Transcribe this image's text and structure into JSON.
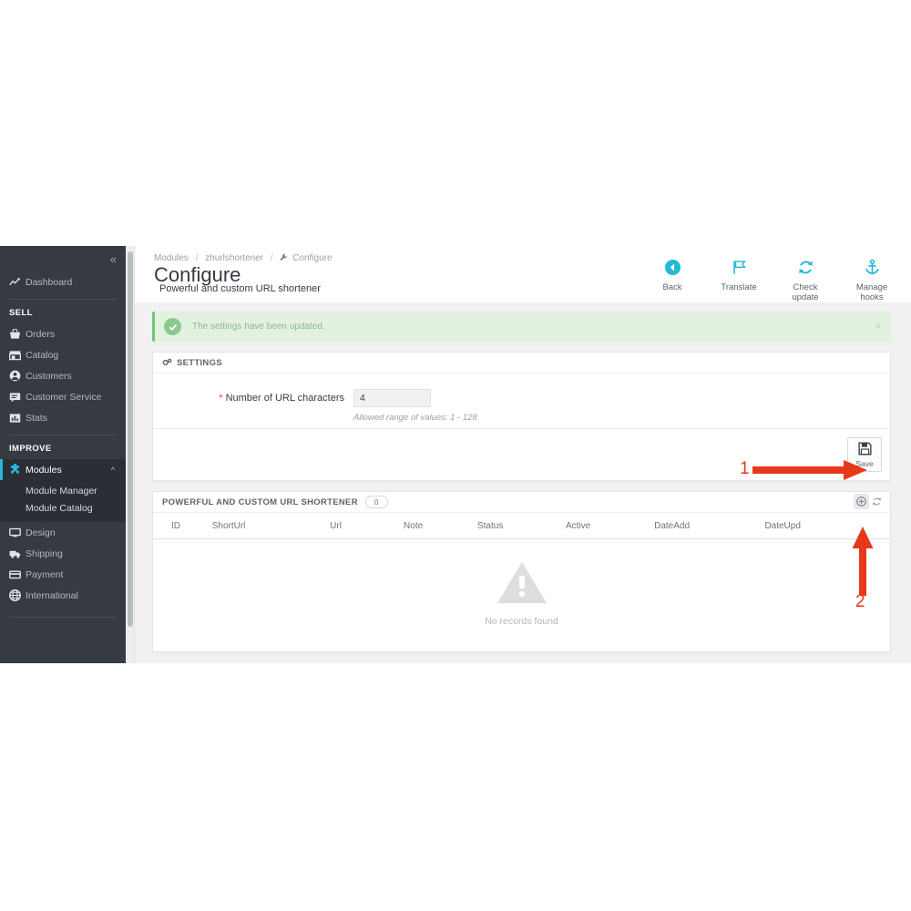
{
  "sidebar": {
    "collapse_icon": "chevron-double-left-icon",
    "dashboard": {
      "label": "Dashboard",
      "icon": "trend-chart-icon"
    },
    "sections": [
      {
        "title": "SELL",
        "items": [
          {
            "label": "Orders",
            "icon": "basket-icon"
          },
          {
            "label": "Catalog",
            "icon": "store-icon"
          },
          {
            "label": "Customers",
            "icon": "person-icon"
          },
          {
            "label": "Customer Service",
            "icon": "chat-icon"
          },
          {
            "label": "Stats",
            "icon": "bar-chart-icon"
          }
        ]
      },
      {
        "title": "IMPROVE",
        "items": [
          {
            "label": "Modules",
            "icon": "puzzle-icon",
            "active": true,
            "chevron": "chevron-up-icon",
            "submenu": [
              "Module Manager",
              "Module Catalog"
            ]
          },
          {
            "label": "Design",
            "icon": "monitor-icon"
          },
          {
            "label": "Shipping",
            "icon": "truck-icon"
          },
          {
            "label": "Payment",
            "icon": "credit-card-icon"
          },
          {
            "label": "International",
            "icon": "globe-icon"
          }
        ]
      }
    ]
  },
  "header": {
    "breadcrumb": {
      "root": "Modules",
      "module": "zhurlshortener",
      "current": "Configure",
      "separator": "/"
    },
    "title": "Configure",
    "subtitle": "Powerful and custom URL shortener",
    "toolbar": [
      {
        "label": "Back",
        "icon": "arrow-left-circle-icon"
      },
      {
        "label": "Translate",
        "icon": "flag-icon"
      },
      {
        "label": "Check update",
        "icon": "refresh-icon"
      },
      {
        "label": "Manage hooks",
        "icon": "anchor-icon"
      }
    ]
  },
  "alert": {
    "message": "The settings have been updated.",
    "icon": "check-circle-icon",
    "close_label": "×",
    "color": "#e3f1e1",
    "accent": "#72c479"
  },
  "settings_panel": {
    "title": "SETTINGS",
    "icon": "cogs-icon",
    "field": {
      "label": "Number of URL characters",
      "required_marker": "*",
      "value": "4",
      "placeholder": "",
      "help": "Allowed range of values: 1 - 128"
    },
    "save_label": "Save",
    "save_icon": "floppy-disk-icon"
  },
  "list_panel": {
    "title": "POWERFUL AND CUSTOM URL SHORTENER",
    "count": "0",
    "actions": [
      {
        "name": "add-new-record-button",
        "icon": "plus-circle-icon"
      },
      {
        "name": "refresh-list-button",
        "icon": "sync-icon"
      }
    ],
    "columns": [
      "ID",
      "ShortUrl",
      "Url",
      "Note",
      "Status",
      "Active",
      "DateAdd",
      "DateUpd"
    ],
    "rows": [],
    "empty_text": "No records found",
    "empty_icon": "warning-triangle-icon"
  },
  "annotations": [
    {
      "number": "1",
      "direction": "right",
      "target": "save-button"
    },
    {
      "number": "2",
      "direction": "up",
      "target": "add-new-record-button"
    }
  ],
  "colors": {
    "accent_blue": "#25b9d7",
    "sidebar_bg": "#363a41",
    "annotation_red": "#e8381a",
    "success_green": "#72c479"
  }
}
